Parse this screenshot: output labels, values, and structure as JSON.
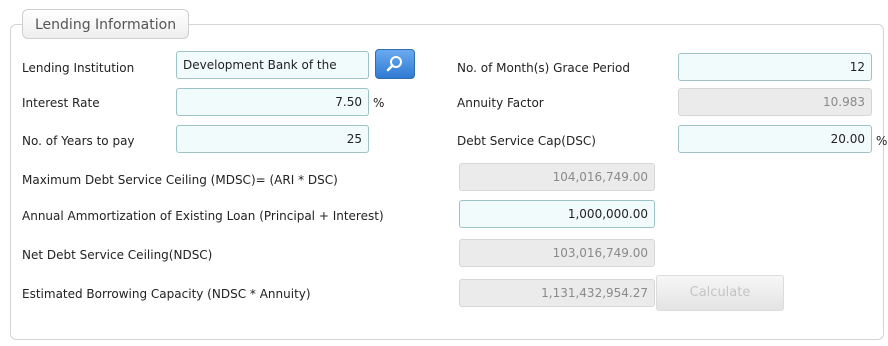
{
  "panel": {
    "title": "Lending Information"
  },
  "fields": {
    "lending_institution": {
      "label": "Lending Institution",
      "value": "Development Bank of the"
    },
    "interest_rate": {
      "label": "Interest Rate",
      "value": "7.50",
      "unit": "%"
    },
    "years_to_pay": {
      "label": "No. of Years to pay",
      "value": "25"
    },
    "grace_period": {
      "label": "No. of Month(s) Grace Period",
      "value": "12"
    },
    "annuity_factor": {
      "label": "Annuity Factor",
      "value": "10.983"
    },
    "debt_service_cap": {
      "label": "Debt Service Cap(DSC)",
      "value": "20.00",
      "unit": "%"
    },
    "mdsc": {
      "label": "Maximum Debt Service Ceiling (MDSC)= (ARI * DSC)",
      "value": "104,016,749.00"
    },
    "annual_amortization": {
      "label": "Annual Ammortization of Existing Loan (Principal + Interest)",
      "value": "1,000,000.00"
    },
    "ndsc": {
      "label": "Net Debt Service Ceiling(NDSC)",
      "value": "103,016,749.00"
    },
    "borrowing_capacity": {
      "label": "Estimated Borrowing Capacity (NDSC * Annuity)",
      "value": "1,131,432,954.27"
    }
  },
  "buttons": {
    "calculate": "Calculate"
  },
  "icons": {
    "search": "search-icon"
  },
  "colors": {
    "input_bg": "#f2fbfb",
    "input_border": "#9ec3c6",
    "readonly_bg": "#ebebeb",
    "search_button": "#2f7ad4"
  }
}
